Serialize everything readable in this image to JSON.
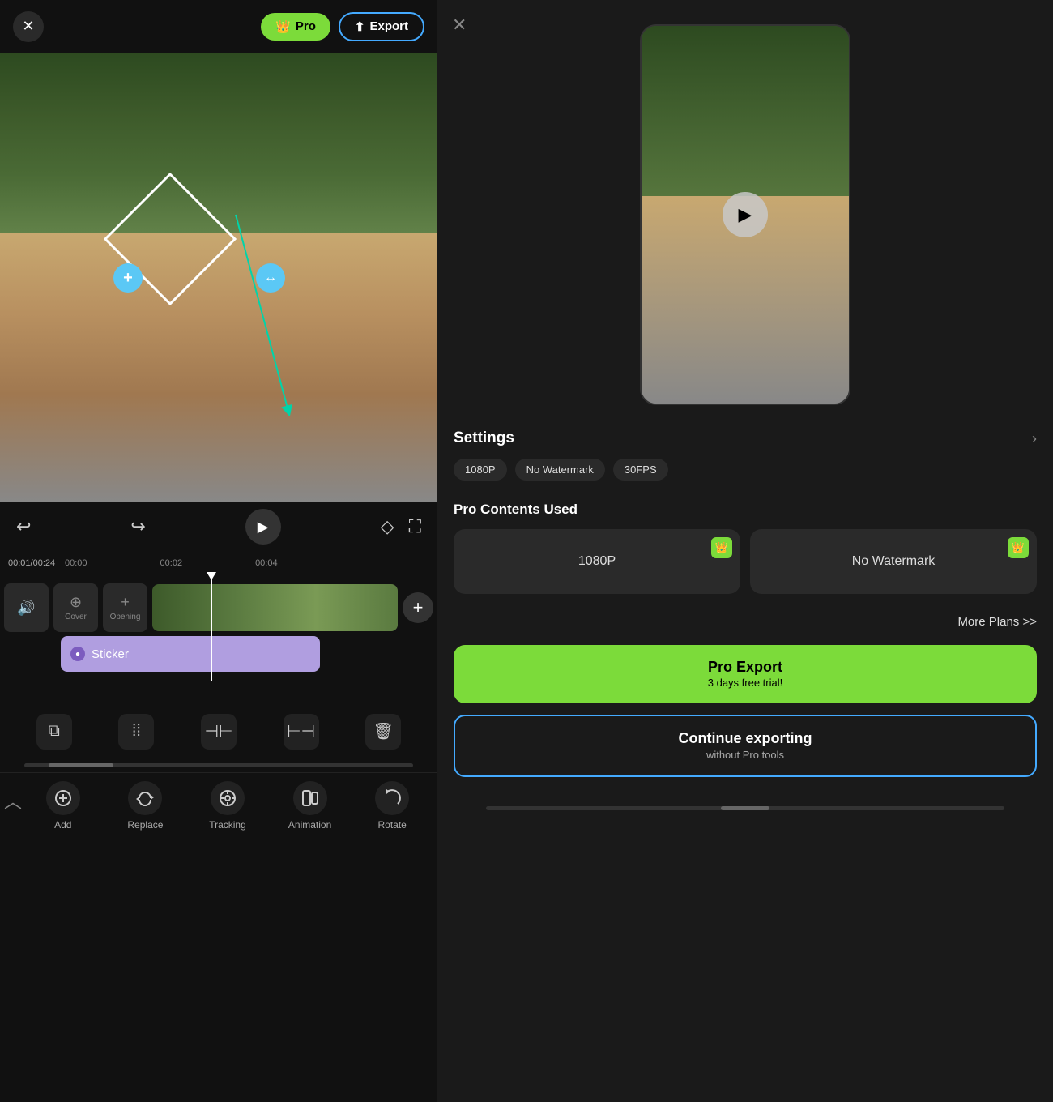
{
  "leftPanel": {
    "closeBtn": "✕",
    "proBtn": "Pro",
    "exportBtn": "Export",
    "timeCode": "00:01/00:24",
    "rulerTimes": [
      "00:00",
      "00:02",
      "00:04"
    ],
    "coverLabel": "Cover",
    "openingLabel": "Opening",
    "stickerLabel": "Sticker",
    "addBtn": "+",
    "editTools": [
      "⧉",
      "⠿⠿",
      "⊣⊢",
      "⊢⊣",
      "🗑"
    ],
    "bottomTools": [
      {
        "icon": "⊕",
        "label": "Add"
      },
      {
        "icon": "↻",
        "label": "Replace"
      },
      {
        "icon": "◎",
        "label": "Tracking"
      },
      {
        "icon": "▣",
        "label": "Animation"
      },
      {
        "icon": "↺",
        "label": "Rotate"
      }
    ]
  },
  "rightPanel": {
    "closeBtn": "✕",
    "settingsTitle": "Settings",
    "settingsArrow": "›",
    "badges": [
      "1080P",
      "No Watermark",
      "30FPS"
    ],
    "proContentsTitle": "Pro Contents Used",
    "proCards": [
      {
        "label": "1080P"
      },
      {
        "label": "No Watermark"
      }
    ],
    "morePlans": "More Plans >>",
    "proExportTitle": "Pro Export",
    "proExportSub": "3 days free trial!",
    "continueTitle": "Continue exporting",
    "continueSub": "without Pro tools"
  }
}
